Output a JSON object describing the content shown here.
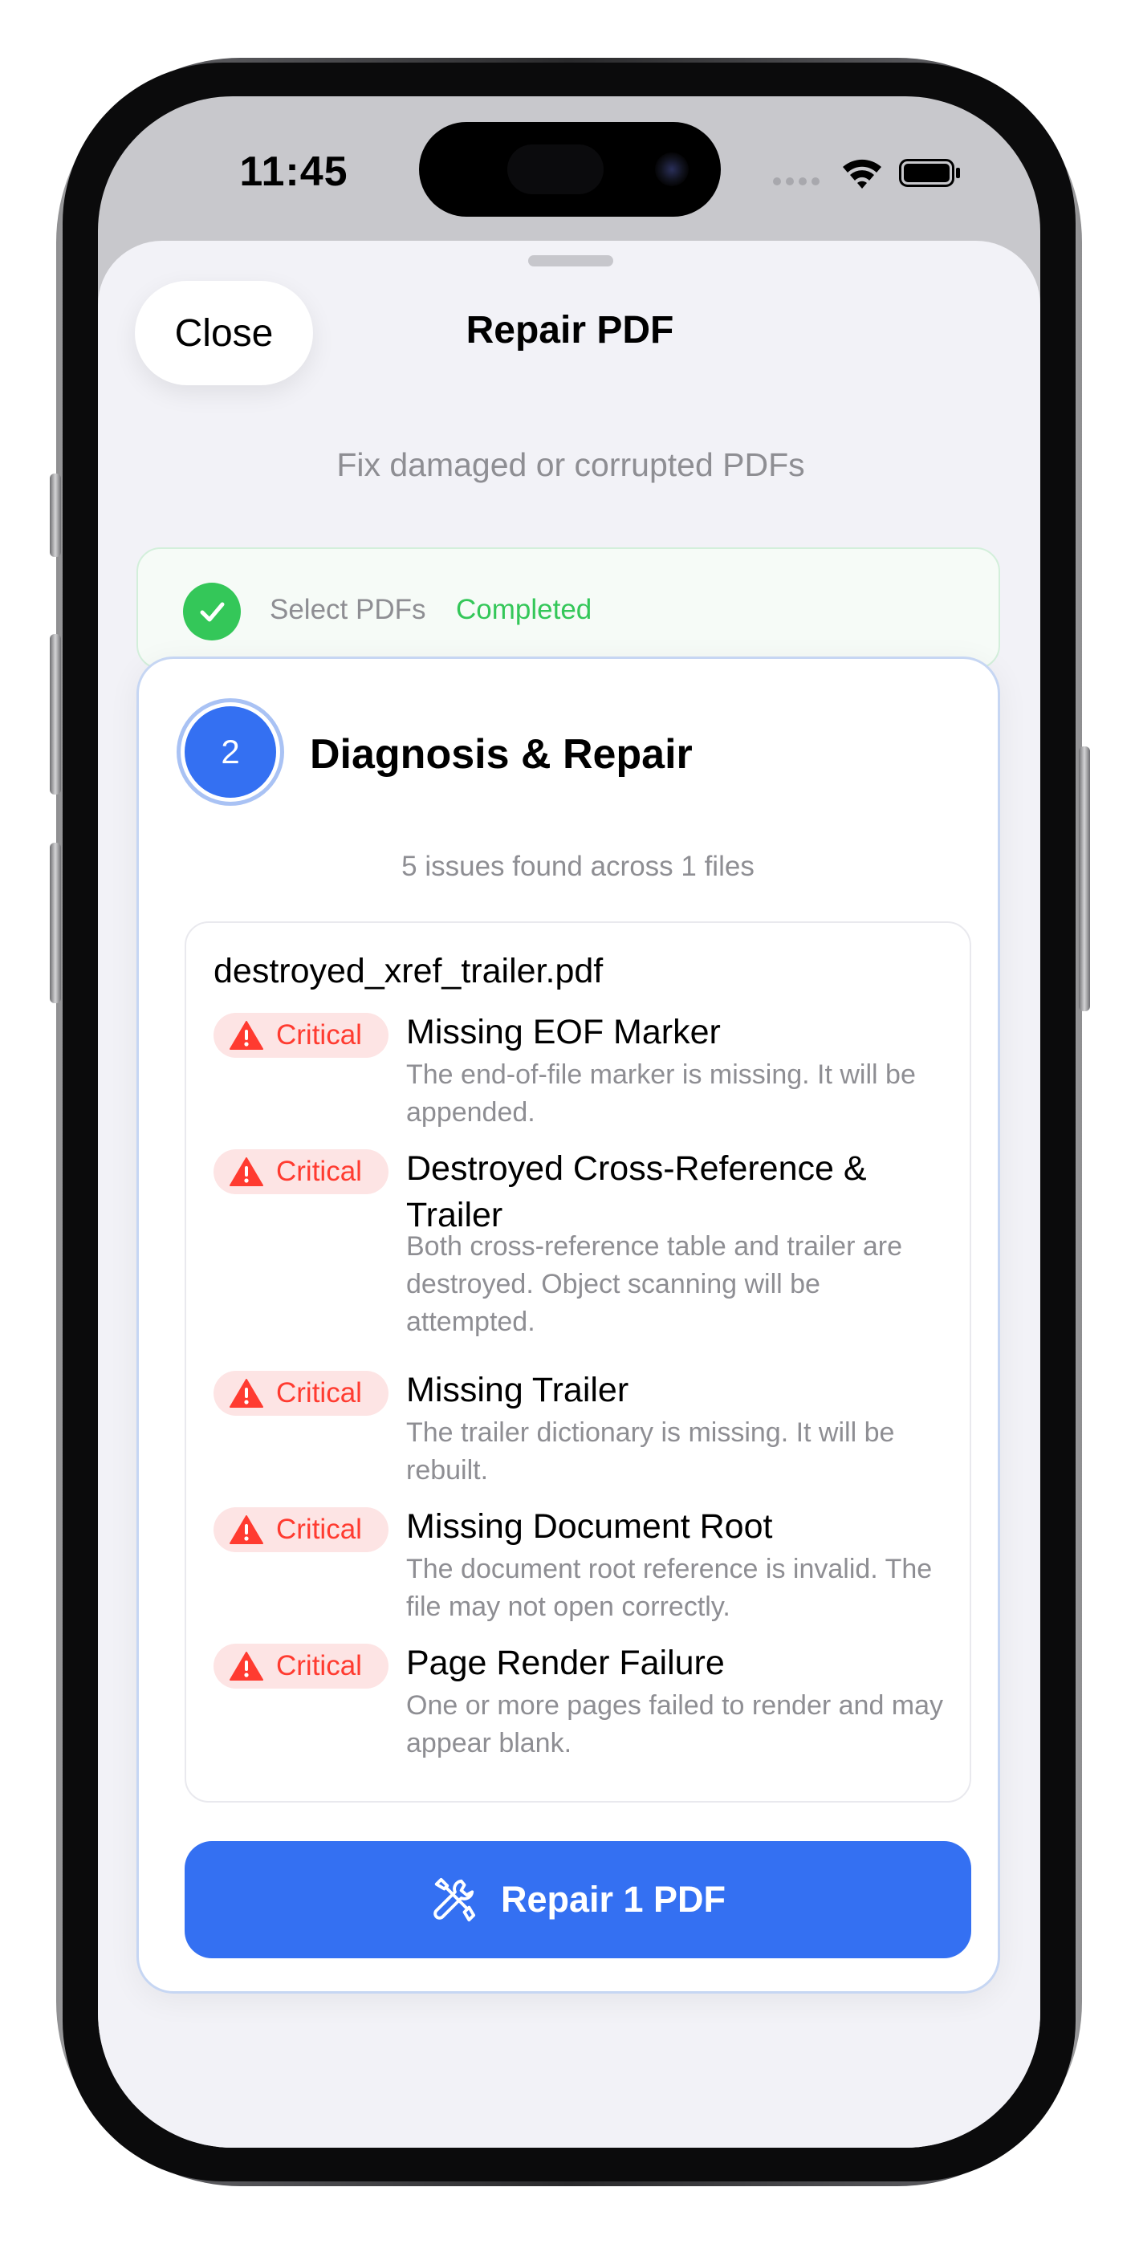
{
  "status_bar": {
    "time": "11:45",
    "icons": [
      "cellular-dots-icon",
      "wifi-icon",
      "battery-icon"
    ]
  },
  "sheet": {
    "close_label": "Close",
    "title": "Repair PDF",
    "subtitle": "Fix damaged or corrupted PDFs"
  },
  "step1": {
    "label": "Select PDFs",
    "status": "Completed"
  },
  "step2": {
    "number": "2",
    "title": "Diagnosis & Repair",
    "summary": "5 issues found across 1 files",
    "file_name": "destroyed_xref_trailer.pdf",
    "issues": [
      {
        "severity": "Critical",
        "title": "Missing EOF Marker",
        "description": "The end-of-file marker is missing. It will be appended."
      },
      {
        "severity": "Critical",
        "title": "Destroyed Cross-Reference & Trailer",
        "description": "Both cross-reference table and trailer are destroyed. Object scanning will be attempted."
      },
      {
        "severity": "Critical",
        "title": "Missing Trailer",
        "description": "The trailer dictionary is missing. It will be rebuilt."
      },
      {
        "severity": "Critical",
        "title": "Missing Document Root",
        "description": "The document root reference is invalid. The file may not open correctly."
      },
      {
        "severity": "Critical",
        "title": "Page Render Failure",
        "description": "One or more pages failed to render and may appear blank."
      }
    ],
    "repair_button_label": "Repair 1 PDF"
  },
  "colors": {
    "accent": "#3470f2",
    "success": "#34c759",
    "critical": "#ff3b30",
    "critical_bg": "#fde4e4",
    "secondary_text": "#8e8e93"
  }
}
